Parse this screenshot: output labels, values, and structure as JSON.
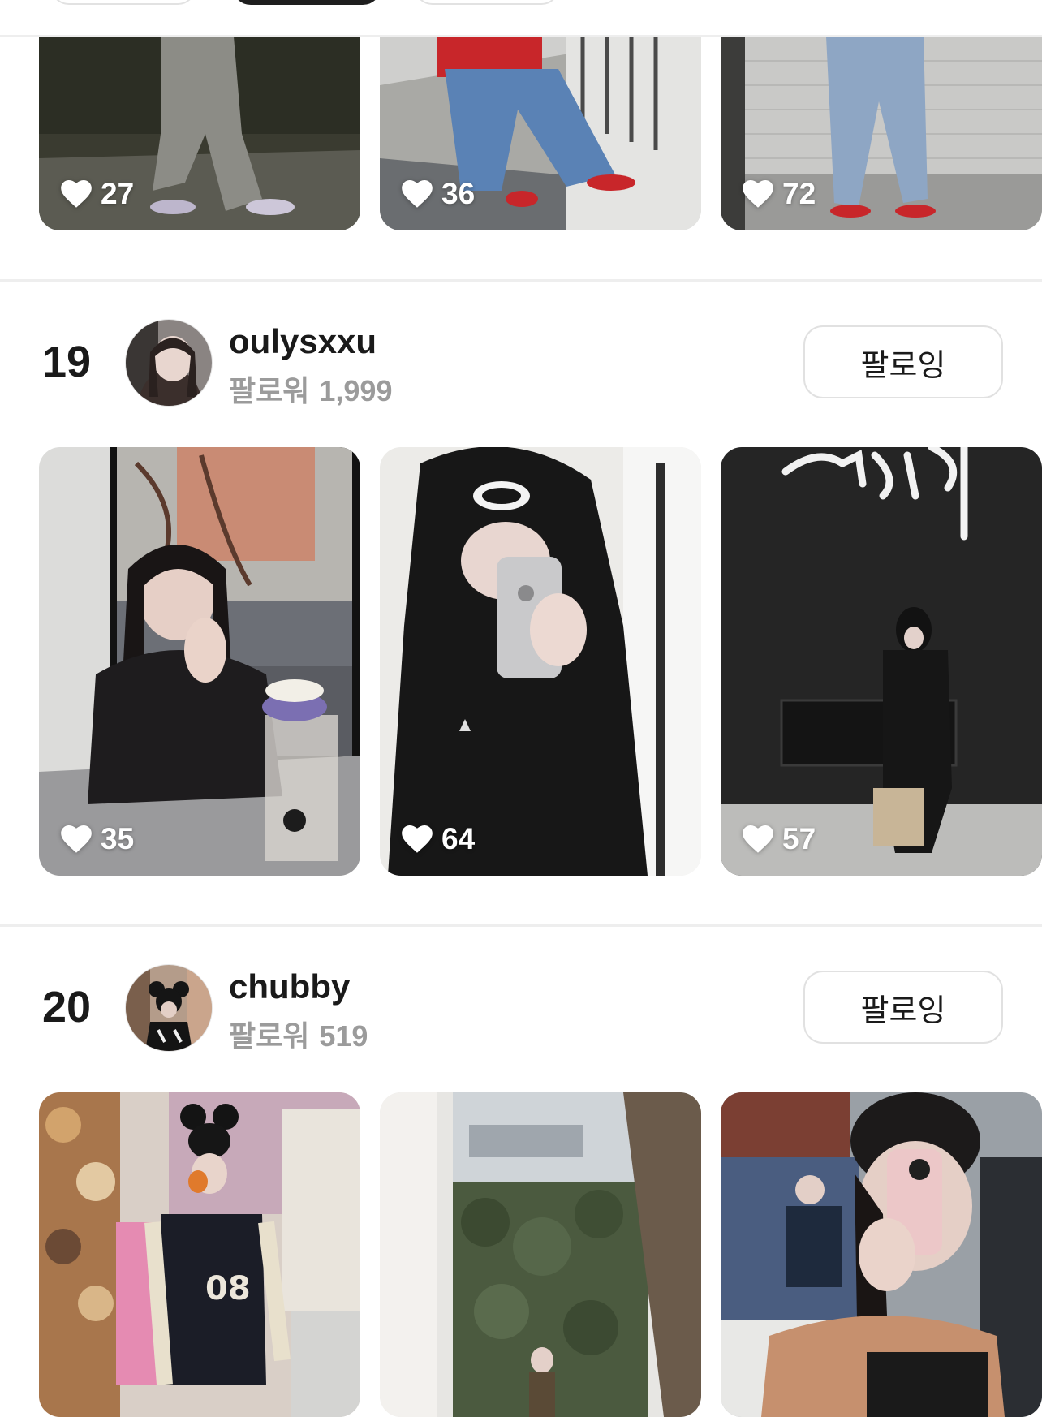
{
  "colors": {
    "text": "#1a1a1a",
    "muted": "#9b9b9b",
    "divider": "#eeeeee",
    "button_border": "#e1e1e1"
  },
  "top_row": {
    "posts": [
      {
        "likes": "27",
        "icon": "heart-icon"
      },
      {
        "likes": "36",
        "icon": "heart-icon"
      },
      {
        "likes": "72",
        "icon": "heart-icon"
      }
    ]
  },
  "users": [
    {
      "rank": "19",
      "username": "oulysxxu",
      "followers_label": "팔로워",
      "followers_count": "1,999",
      "follow_button": "팔로잉",
      "posts": [
        {
          "likes": "35",
          "icon": "heart-icon"
        },
        {
          "likes": "64",
          "icon": "heart-icon"
        },
        {
          "likes": "57",
          "icon": "heart-icon"
        }
      ]
    },
    {
      "rank": "20",
      "username": "chubby",
      "followers_label": "팔로워",
      "followers_count": "519",
      "follow_button": "팔로잉",
      "posts": [
        {
          "icon": "photo"
        },
        {
          "icon": "photo"
        },
        {
          "icon": "photo"
        }
      ]
    }
  ]
}
